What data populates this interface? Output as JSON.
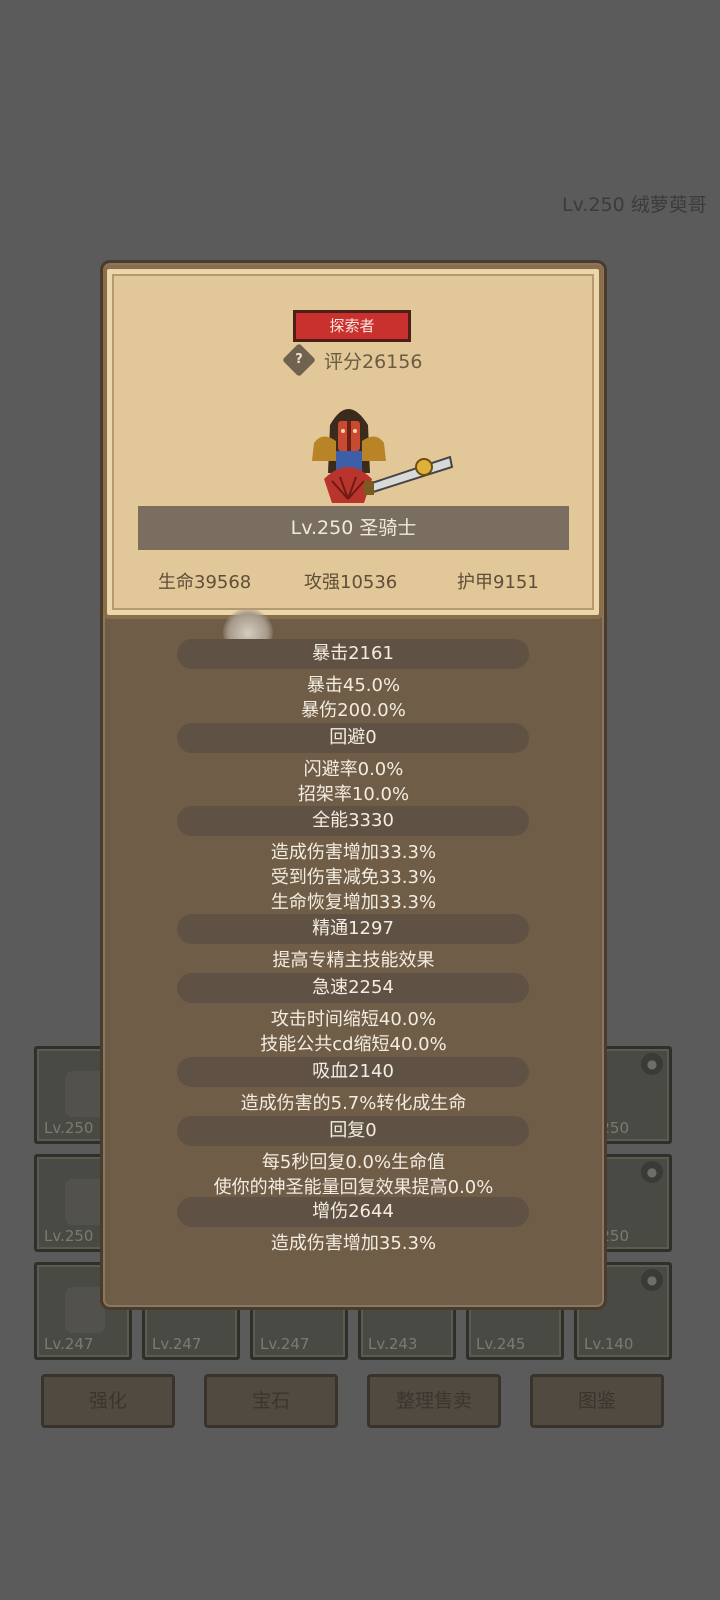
{
  "background": {
    "header_text": "Lv.250 绒萝萸哥",
    "equipment_levels": [
      "Lv.250",
      "Lv.250",
      "Lv.247",
      "Lv.247",
      "Lv.247",
      "Lv.243",
      "Lv.245",
      "Lv.140",
      "250",
      "250"
    ],
    "buttons": [
      "强化",
      "宝石",
      "整理售卖",
      "图鉴"
    ]
  },
  "profile": {
    "title_badge": "探索者",
    "help_icon": "question-mark-icon",
    "score": "评分26156",
    "name": "Lv.250 圣骑士",
    "stats": {
      "hp": "生命39568",
      "attack": "攻强10536",
      "armor": "护甲9151"
    }
  },
  "attributes": [
    {
      "header": "暴击2161",
      "details": [
        "暴击45.0%",
        "暴伤200.0%"
      ]
    },
    {
      "header": "回避0",
      "details": [
        "闪避率0.0%",
        "招架率10.0%"
      ]
    },
    {
      "header": "全能3330",
      "details": [
        "造成伤害增加33.3%",
        "受到伤害减免33.3%",
        "生命恢复增加33.3%"
      ]
    },
    {
      "header": "精通1297",
      "details": [
        "提高专精主技能效果"
      ]
    },
    {
      "header": "急速2254",
      "details": [
        "攻击时间缩短40.0%",
        "技能公共cd缩短40.0%"
      ]
    },
    {
      "header": "吸血2140",
      "details": [
        "造成伤害的5.7%转化成生命"
      ]
    },
    {
      "header": "回复0",
      "details": [
        "每5秒回复0.0%生命值",
        "使你的神圣能量回复效果提高0.0%"
      ]
    },
    {
      "header": "增伤2644",
      "details": [
        "造成伤害增加35.3%"
      ]
    }
  ],
  "colors": {
    "overlay_bg": "#5b5b5b",
    "card_bg": "#e2c898",
    "badge_red": "#c8312d",
    "panel_bg": "#6f5d47"
  }
}
